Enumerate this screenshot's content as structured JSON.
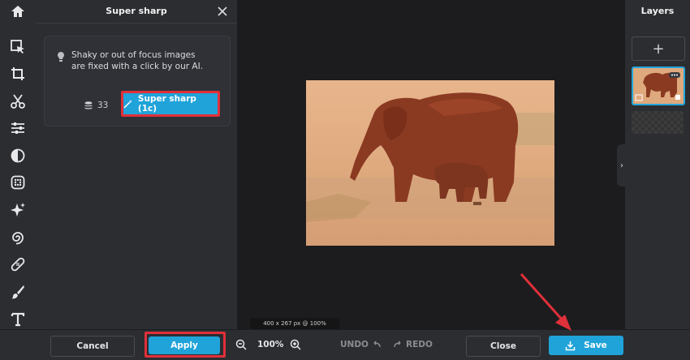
{
  "panel": {
    "title": "Super sharp",
    "description": "Shaky or out of focus images are fixed with a click by our AI.",
    "credits": "33",
    "super_sharp_label": "Super sharp (1c)"
  },
  "canvas": {
    "info": "400 x 267 px @ 100%"
  },
  "layers": {
    "title": "Layers",
    "add_label": "+"
  },
  "bottom": {
    "cancel_label": "Cancel",
    "apply_label": "Apply",
    "zoom_level": "100%",
    "undo_label": "UNDO",
    "redo_label": "REDO",
    "close_label": "Close",
    "save_label": "Save"
  },
  "colors": {
    "accent": "#1fa3d9",
    "highlight": "#e0303a",
    "panel_bg": "#2b2d31",
    "canvas_bg": "#1c1c1e"
  },
  "icons": [
    "home-icon",
    "select-icon",
    "crop-icon",
    "cut-icon",
    "adjust-icon",
    "filter-icon",
    "effects-icon",
    "ai-sparkle-icon",
    "swirl-icon",
    "bandage-icon",
    "brush-icon",
    "text-icon",
    "pattern-icon",
    "close-icon",
    "bulb-icon",
    "coins-icon",
    "magic-wand-icon",
    "zoom-out-icon",
    "zoom-in-icon",
    "undo-icon",
    "redo-icon",
    "download-icon",
    "chevron-right-icon"
  ]
}
